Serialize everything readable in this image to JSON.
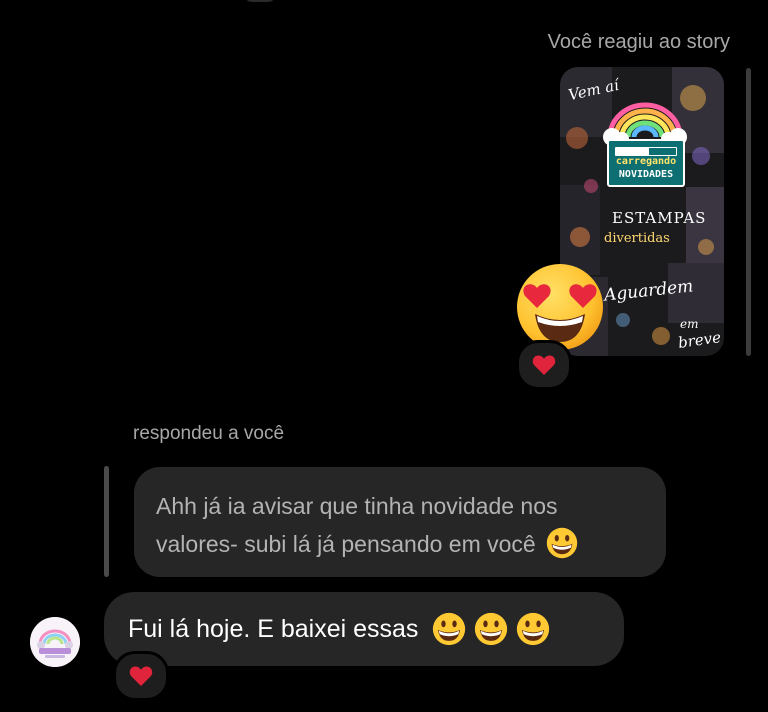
{
  "thread": {
    "story_reaction_label": "Você reagiu ao story",
    "story": {
      "text_vem": "Vem aí",
      "loader_line1": "carregando",
      "loader_line2": "NOVIDADES",
      "loader_progress": 0.55,
      "text_estampas": "ESTAMPAS",
      "text_divertidas": "divertidas",
      "text_aguardem": "Aguardem",
      "text_em": "em",
      "text_breve": "breve"
    },
    "story_emoji": "heart-eyes-emoji",
    "story_reaction_icon": "heart-icon",
    "reply_label": "respondeu a você",
    "quoted_message": "Ahh já ia avisar que tinha novidade nos valores- subi lá já pensando em você",
    "quoted_emoji": "grinning-face-emoji",
    "message": {
      "text": "Fui lá hoje. E baixei essas",
      "emoji_count": 3,
      "emoji": "grinning-face-emoji",
      "reaction_icon": "heart-icon"
    }
  },
  "colors": {
    "background": "#000000",
    "bubble": "#262626",
    "meta_text": "#a8a8a8",
    "heart": "#e0243c",
    "emoji_yellow": "#ffc933"
  }
}
